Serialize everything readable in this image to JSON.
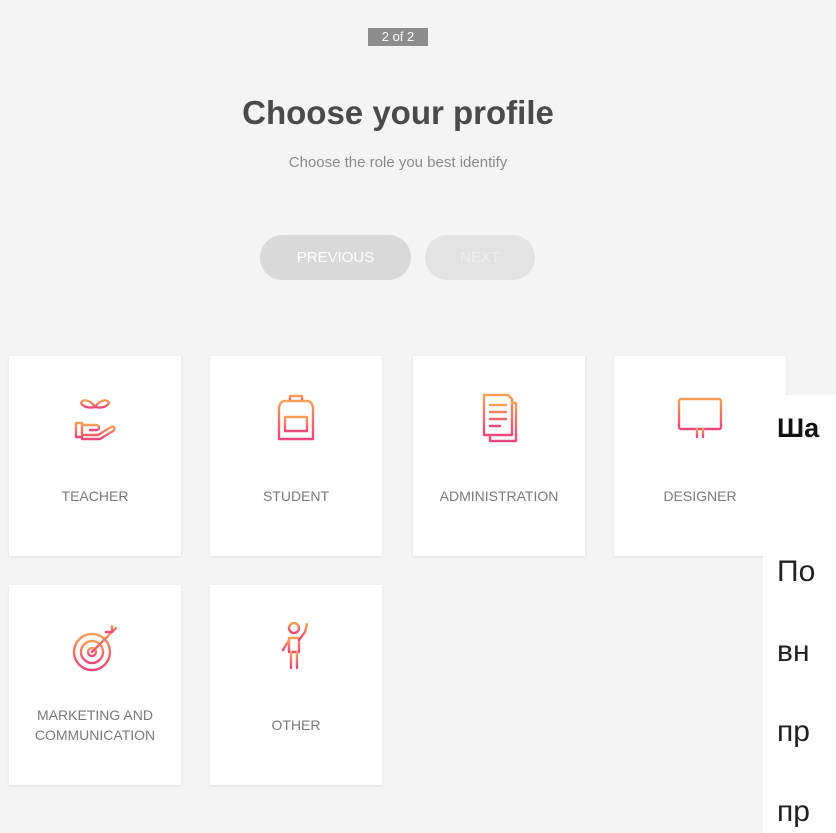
{
  "header": {
    "step_badge": "2 of 2",
    "title": "Choose your profile",
    "subtitle": "Choose the role you best identify"
  },
  "navigation": {
    "previous_label": "PREVIOUS",
    "next_label": "NEXT"
  },
  "roles": [
    {
      "label": "TEACHER",
      "icon": "plant-hand-icon"
    },
    {
      "label": "STUDENT",
      "icon": "backpack-icon"
    },
    {
      "label": "ADMINISTRATION",
      "icon": "document-icon"
    },
    {
      "label": "DESIGNER",
      "icon": "monitor-icon"
    },
    {
      "label": "MARKETING AND COMMUNICATION",
      "icon": "target-icon"
    },
    {
      "label": "OTHER",
      "icon": "person-waving-icon"
    }
  ],
  "side_text": {
    "heading": "Ша",
    "lines": [
      "По",
      "вн",
      "пр",
      "пр"
    ]
  },
  "colors": {
    "background": "#f4f4f4",
    "card": "#ffffff",
    "gradient_start": "#f5a05a",
    "gradient_end": "#e8487a",
    "button_disabled": "#d9d9d9"
  }
}
